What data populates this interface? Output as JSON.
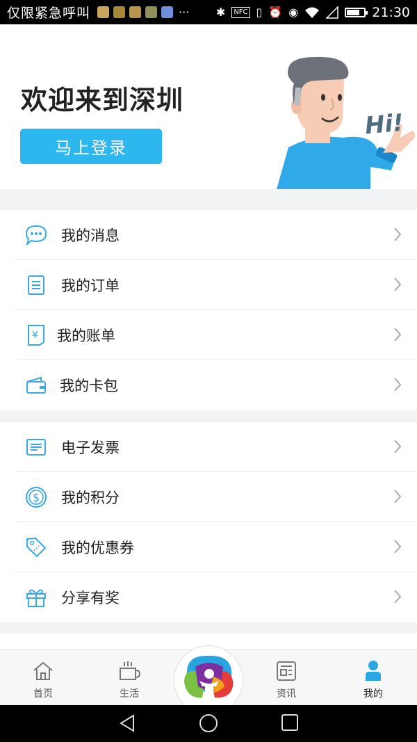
{
  "status_bar": {
    "carrier": "仅限紧急呼叫",
    "overflow": "···",
    "nfc": "NFC",
    "time": "21:30"
  },
  "hero": {
    "welcome": "欢迎来到深圳",
    "login_button": "马上登录",
    "mascot_greeting": "Hi!"
  },
  "menu_group_1": [
    {
      "label": "我的消息",
      "icon": "message-bubble-icon"
    },
    {
      "label": "我的订单",
      "icon": "order-document-icon"
    },
    {
      "label": "我的账单",
      "icon": "bill-yen-icon"
    },
    {
      "label": "我的卡包",
      "icon": "wallet-icon"
    }
  ],
  "menu_group_2": [
    {
      "label": "电子发票",
      "icon": "invoice-icon"
    },
    {
      "label": "我的积分",
      "icon": "points-dollar-icon"
    },
    {
      "label": "我的优惠券",
      "icon": "coupon-tag-icon"
    },
    {
      "label": "分享有奖",
      "icon": "gift-icon"
    }
  ],
  "tab_bar": {
    "tabs": [
      {
        "label": "首页",
        "icon": "home-icon"
      },
      {
        "label": "生活",
        "icon": "coffee-cup-icon"
      },
      {
        "label": "资讯",
        "icon": "news-icon"
      },
      {
        "label": "我的",
        "icon": "person-icon",
        "active": true
      }
    ],
    "center_icon": "city-logo-icon"
  },
  "colors": {
    "accent": "#2cb7ee",
    "icon_blue": "#3aa7e6",
    "text": "#222222",
    "divider": "#e6e6e6"
  }
}
